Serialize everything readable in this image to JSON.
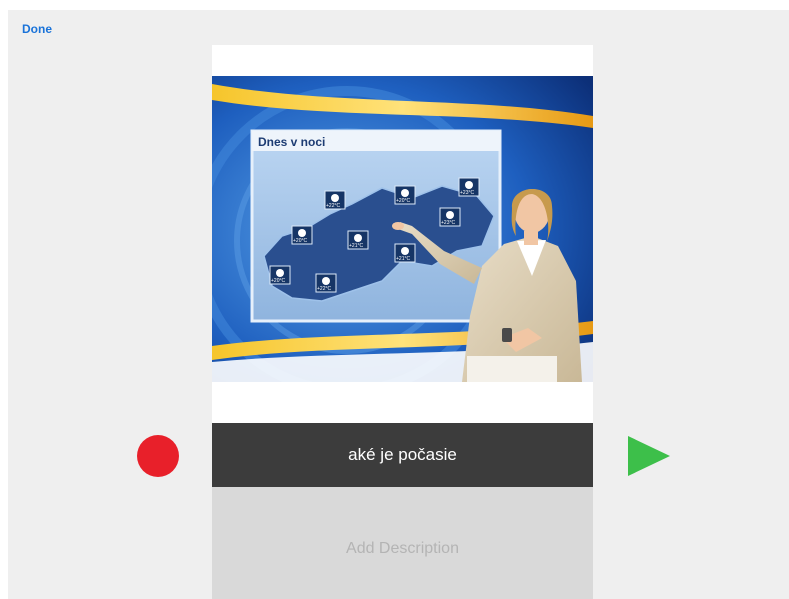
{
  "toolbar": {
    "done_label": "Done"
  },
  "card": {
    "image_heading": "Dnes v noci",
    "temperatures": [
      "+22°C",
      "+20°C",
      "+23°C",
      "+20°C",
      "+21°C",
      "+23°C",
      "+20°C",
      "+22°C",
      "+21°C"
    ],
    "caption": "aké je počasie",
    "description_placeholder": "Add Description"
  },
  "colors": {
    "accent": "#1a73d9",
    "record": "#e8202a",
    "play": "#3dbf4a",
    "caption_bg": "#3c3c3c"
  }
}
